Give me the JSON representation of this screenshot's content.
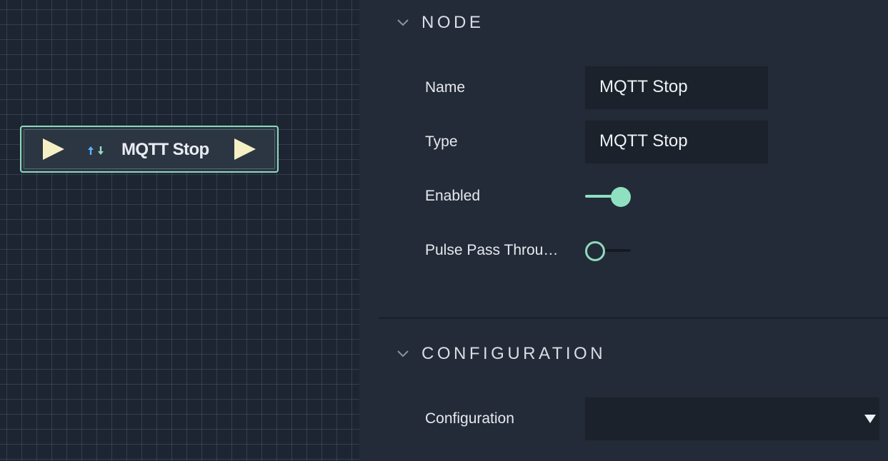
{
  "canvas": {
    "node": {
      "title": "MQTT Stop",
      "icon": "mqtt-arrows-icon",
      "input_pulse_icon": "pulse-input-icon",
      "output_pulse_icon": "pulse-output-icon"
    }
  },
  "panel": {
    "node_section": {
      "title": "NODE",
      "name_label": "Name",
      "name_value": "MQTT Stop",
      "type_label": "Type",
      "type_value": "MQTT Stop",
      "enabled_label": "Enabled",
      "enabled": true,
      "pulse_label": "Pulse Pass Throu…",
      "pulse_pass_through": false
    },
    "config_section": {
      "title": "CONFIGURATION",
      "config_label": "Configuration",
      "config_value": ""
    }
  },
  "colors": {
    "accent": "#8fd9bd",
    "pulse": "#f5efc4",
    "panel_bg": "#232b38",
    "field_bg": "#1c222b",
    "canvas_bg": "#1d2533"
  }
}
